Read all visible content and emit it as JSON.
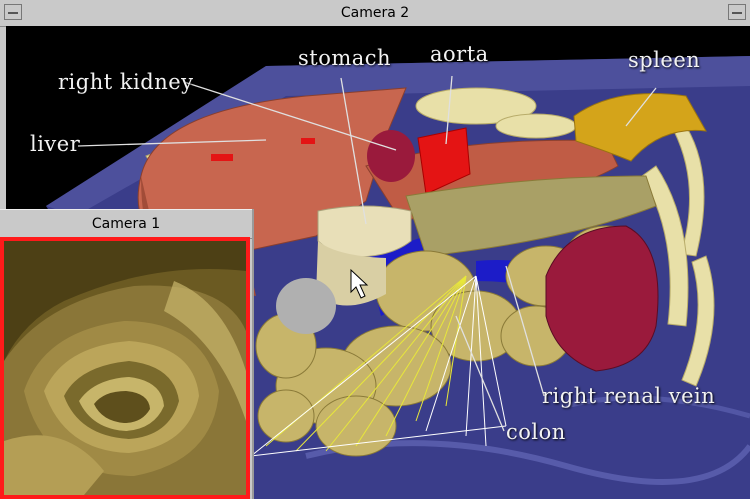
{
  "windows": {
    "camera2": {
      "title": "Camera 2"
    },
    "camera1": {
      "title": "Camera 1"
    }
  },
  "labels": {
    "right_kidney": "right kidney",
    "stomach": "stomach",
    "aorta": "aorta",
    "spleen": "spleen",
    "liver": "liver",
    "right_renal_vein": "right renal vein",
    "colon": "colon"
  },
  "colors": {
    "window_chrome": "#c9c9c9",
    "table_surface": "#3a3d8a",
    "liver": "#c8664f",
    "colon": "#c7b56a",
    "kidney": "#9a1a3c",
    "aorta": "#e41414",
    "spleen": "#d4a41a",
    "vein": "#1c1cc8",
    "camera1_border": "#ff1a1a",
    "label_text": "#f2f2f2"
  }
}
